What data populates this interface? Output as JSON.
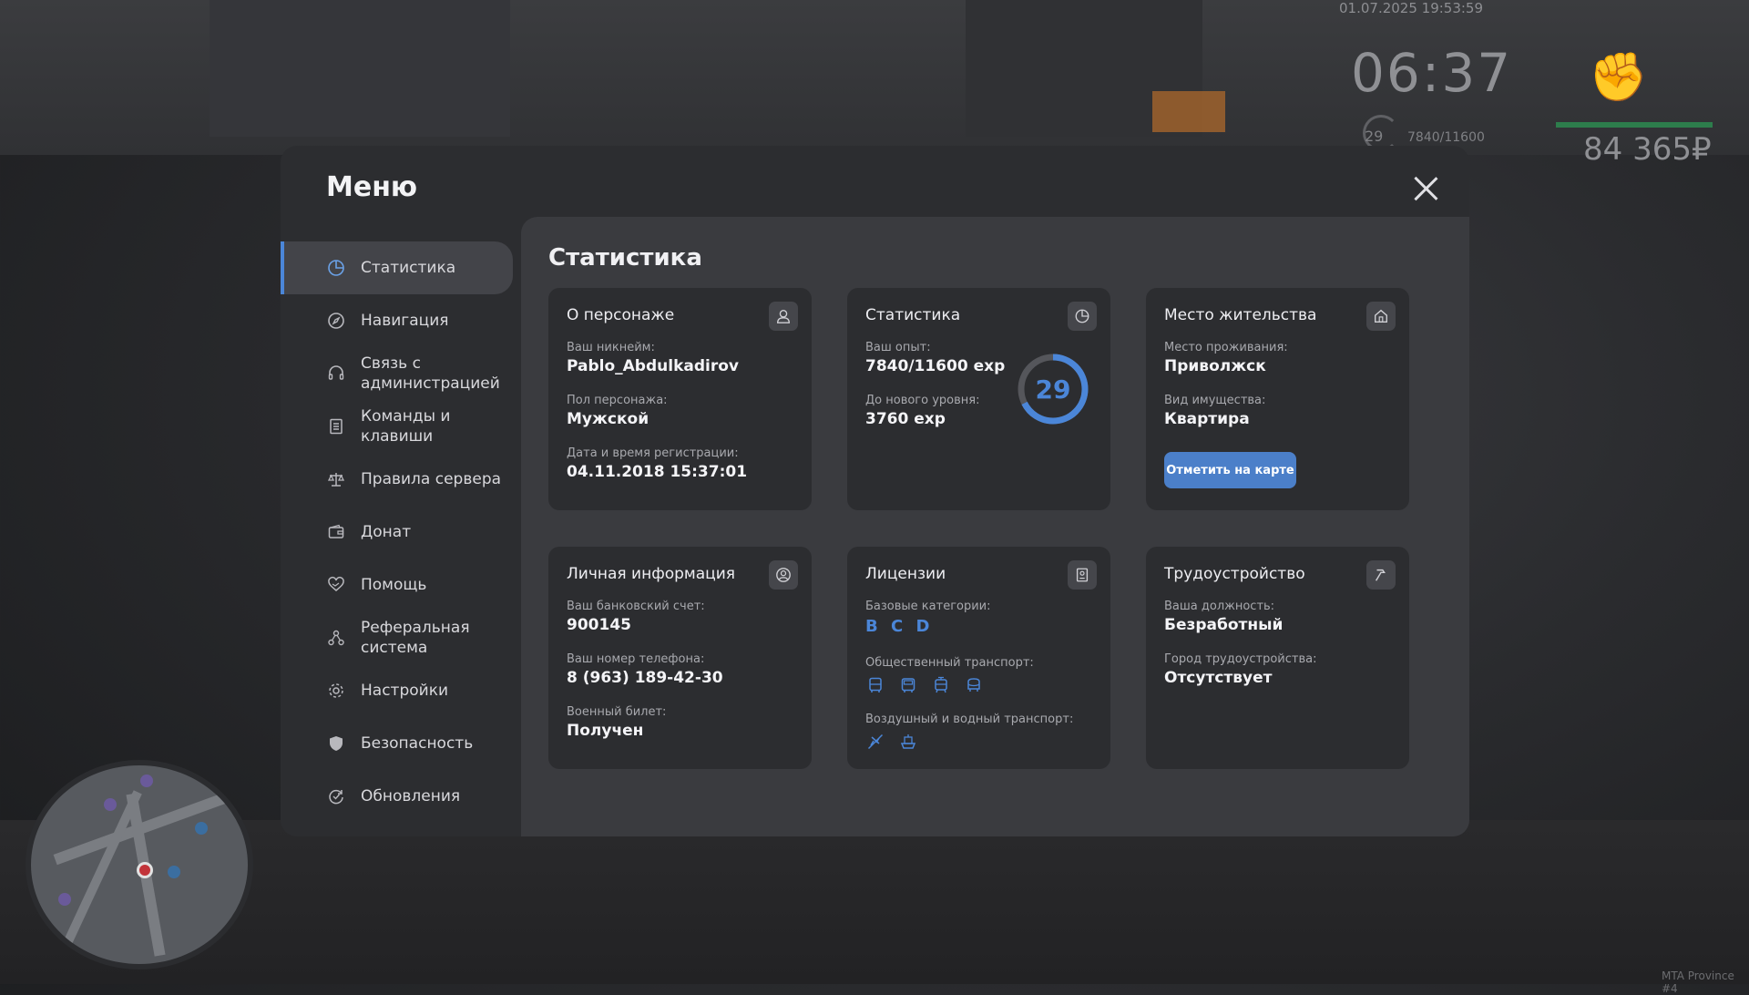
{
  "hud": {
    "datetime": "01.07.2025 19:53:59",
    "clock": "06:37",
    "level": "29",
    "exp": "7840/11600",
    "money": "84 365₽",
    "server": "MTA Province #4"
  },
  "menu": {
    "title": "Меню",
    "close_icon": "close-icon"
  },
  "sidebar": {
    "items": [
      {
        "label": "Статистика",
        "icon": "pie-chart-icon",
        "active": true
      },
      {
        "label": "Навигация",
        "icon": "compass-icon"
      },
      {
        "label": "Связь с администрацией",
        "icon": "headset-icon"
      },
      {
        "label": "Команды и клавиши",
        "icon": "document-icon"
      },
      {
        "label": "Правила сервера",
        "icon": "scales-icon"
      },
      {
        "label": "Донат",
        "icon": "wallet-icon"
      },
      {
        "label": "Помощь",
        "icon": "heart-hand-icon"
      },
      {
        "label": "Реферальная система",
        "icon": "network-icon"
      },
      {
        "label": "Настройки",
        "icon": "gear-icon"
      },
      {
        "label": "Безопасность",
        "icon": "shield-icon"
      },
      {
        "label": "Обновления",
        "icon": "refresh-icon"
      }
    ]
  },
  "content": {
    "title": "Статистика",
    "character": {
      "title": "О персонаже",
      "icon": "user-icon",
      "nickname_label": "Ваш никнейм:",
      "nickname": "Pablo_Abdulkadirov",
      "gender_label": "Пол персонажа:",
      "gender": "Мужской",
      "reg_label": "Дата и время регистрации:",
      "reg": "04.11.2018 15:37:01"
    },
    "stats": {
      "title": "Статистика",
      "icon": "pie-chart-icon",
      "exp_label": "Ваш опыт:",
      "exp": "7840/11600 exp",
      "next_label": "До нового уровня:",
      "next": "3760 exp",
      "level": "29",
      "progress": 0.676
    },
    "residence": {
      "title": "Место жительства",
      "icon": "house-icon",
      "place_label": "Место проживания:",
      "place": "Приволжск",
      "type_label": "Вид имущества:",
      "type": "Квартира",
      "button": "Отметить на карте"
    },
    "personal": {
      "title": "Личная информация",
      "icon": "user-circle-icon",
      "bank_label": "Ваш банковский счет:",
      "bank": "900145",
      "phone_label": "Ваш номер телефона:",
      "phone": "8 (963) 189-42-30",
      "military_label": "Военный билет:",
      "military": "Получен"
    },
    "licenses": {
      "title": "Лицензии",
      "icon": "id-card-icon",
      "base_label": "Базовые категории:",
      "base": "B C D",
      "public_label": "Общественный транспорт:",
      "public_icons": [
        "bus-icon",
        "coach-icon",
        "tram-icon",
        "trolleybus-icon"
      ],
      "air_label": "Воздушный и водный транспорт:",
      "air_icons": [
        "plane-icon",
        "boat-icon"
      ]
    },
    "job": {
      "title": "Трудоустройство",
      "icon": "hammer-icon",
      "position_label": "Ваша должность:",
      "position": "Безработный",
      "city_label": "Город трудоустройства:",
      "city": "Отсутствует"
    }
  },
  "colors": {
    "accent": "#4b86d8",
    "panel": "#2c2d30",
    "content": "#3a3b3f"
  }
}
